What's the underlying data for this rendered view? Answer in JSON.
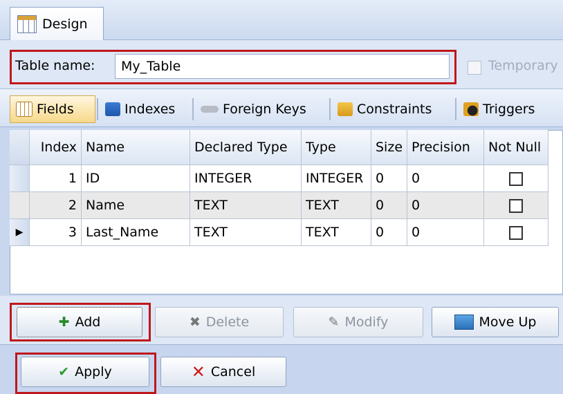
{
  "design_tab": {
    "label": "Design"
  },
  "table_name": {
    "label": "Table name:",
    "value": "My_Table"
  },
  "temporary": {
    "label": "Temporary"
  },
  "subtabs": [
    {
      "label": "Fields"
    },
    {
      "label": "Indexes"
    },
    {
      "label": "Foreign Keys"
    },
    {
      "label": "Constraints"
    },
    {
      "label": "Triggers"
    }
  ],
  "grid": {
    "columns": [
      "Index",
      "Name",
      "Declared Type",
      "Type",
      "Size",
      "Precision",
      "Not Null"
    ],
    "rows": [
      {
        "index": "1",
        "name": "ID",
        "declared_type": "INTEGER",
        "type": "INTEGER",
        "size": "0",
        "precision": "0",
        "not_null": false
      },
      {
        "index": "2",
        "name": "Name",
        "declared_type": "TEXT",
        "type": "TEXT",
        "size": "0",
        "precision": "0",
        "not_null": false
      },
      {
        "index": "3",
        "name": "Last_Name",
        "declared_type": "TEXT",
        "type": "TEXT",
        "size": "0",
        "precision": "0",
        "not_null": false
      }
    ]
  },
  "buttons": {
    "add": "Add",
    "delete": "Delete",
    "modify": "Modify",
    "move_up": "Move Up",
    "apply": "Apply",
    "cancel": "Cancel"
  },
  "colors": {
    "highlight": "#c0171c",
    "background": "#c8d7ee"
  }
}
